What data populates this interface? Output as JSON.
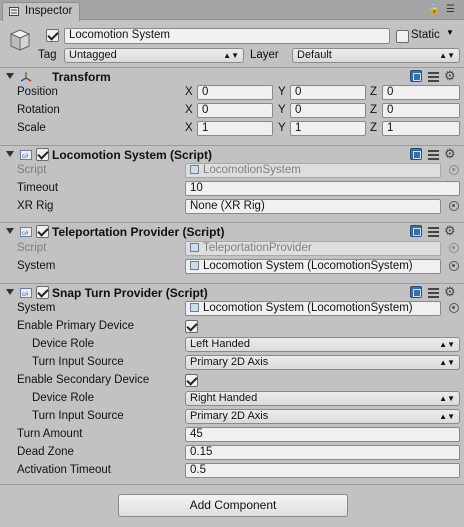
{
  "window": {
    "tab_label": "Inspector"
  },
  "gameobject": {
    "name": "Locomotion System",
    "active": true,
    "static_label": "Static",
    "static_checked": false,
    "tag_label": "Tag",
    "tag_value": "Untagged",
    "layer_label": "Layer",
    "layer_value": "Default"
  },
  "transform": {
    "title": "Transform",
    "position": {
      "label": "Position",
      "x": "0",
      "y": "0",
      "z": "0"
    },
    "rotation": {
      "label": "Rotation",
      "x": "0",
      "y": "0",
      "z": "0"
    },
    "scale": {
      "label": "Scale",
      "x": "1",
      "y": "1",
      "z": "1"
    },
    "axis": {
      "x": "X",
      "y": "Y",
      "z": "Z"
    }
  },
  "locomotion": {
    "title": "Locomotion System (Script)",
    "enabled": true,
    "script_label": "Script",
    "script_value": "LocomotionSystem",
    "timeout_label": "Timeout",
    "timeout_value": "10",
    "xrrig_label": "XR Rig",
    "xrrig_value": "None (XR Rig)"
  },
  "teleport": {
    "title": "Teleportation Provider (Script)",
    "enabled": true,
    "script_label": "Script",
    "script_value": "TeleportationProvider",
    "system_label": "System",
    "system_value": "Locomotion System (LocomotionSystem)"
  },
  "snap": {
    "title": "Snap Turn Provider (Script)",
    "enabled": true,
    "system_label": "System",
    "system_value": "Locomotion System (LocomotionSystem)",
    "enable_primary_label": "Enable Primary Device",
    "enable_primary": true,
    "primary_role_label": "Device Role",
    "primary_role_value": "Left Handed",
    "primary_input_label": "Turn Input Source",
    "primary_input_value": "Primary 2D Axis",
    "enable_secondary_label": "Enable Secondary Device",
    "enable_secondary": true,
    "secondary_role_label": "Device Role",
    "secondary_role_value": "Right Handed",
    "secondary_input_label": "Turn Input Source",
    "secondary_input_value": "Primary 2D Axis",
    "turn_amount_label": "Turn Amount",
    "turn_amount_value": "45",
    "dead_zone_label": "Dead Zone",
    "dead_zone_value": "0.15",
    "activation_timeout_label": "Activation Timeout",
    "activation_timeout_value": "0.5"
  },
  "footer": {
    "add_component_label": "Add Component"
  },
  "icons": {
    "inspector": "inspector-icon",
    "gameobject": "cube-icon",
    "transform": "transform-axes-icon",
    "script": "script-icon",
    "help": "book-icon",
    "presets": "sliders-icon",
    "settings": "gear-icon",
    "object_picker": "object-picker-icon"
  }
}
